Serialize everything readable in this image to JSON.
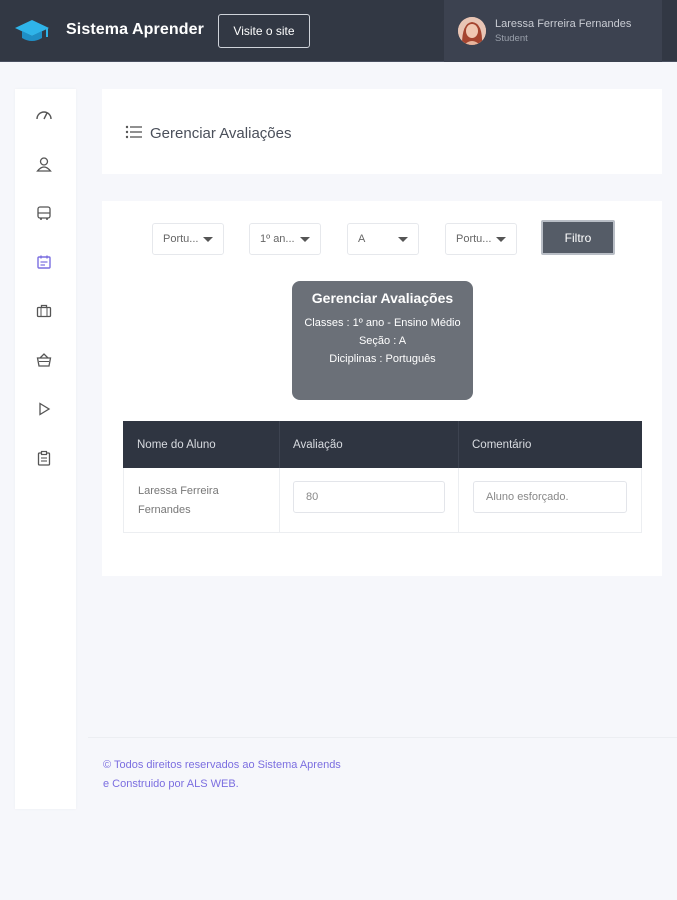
{
  "header": {
    "brand": "Sistema Aprender",
    "visit_label": "Visite o site",
    "user_name": "Laressa Ferreira Fernandes",
    "user_role": "Student"
  },
  "sidebar": {
    "items": [
      {
        "icon": "dashboard-gauge-icon"
      },
      {
        "icon": "user-icon"
      },
      {
        "icon": "bus-icon"
      },
      {
        "icon": "calendar-icon",
        "active": true
      },
      {
        "icon": "briefcase-icon"
      },
      {
        "icon": "basket-icon"
      },
      {
        "icon": "play-icon"
      },
      {
        "icon": "clipboard-icon"
      }
    ]
  },
  "page": {
    "title": "Gerenciar Avaliações"
  },
  "filters": {
    "discipline": "Portu...",
    "class": "1º an...",
    "section": "A",
    "discipline2": "Portu...",
    "filter_label": "Filtro"
  },
  "info": {
    "title": "Gerenciar Avaliações",
    "classes": "Classes : 1º ano - Ensino Médio",
    "section": "Seção : A",
    "disciplines": "Diciplinas : Português"
  },
  "table": {
    "headers": [
      "Nome do Aluno",
      "Avaliação",
      "Comentário"
    ],
    "rows": [
      {
        "name": "Laressa Ferreira Fernandes",
        "grade": "80",
        "comment": "Aluno esforçado."
      }
    ]
  },
  "footer": {
    "text": "© Todos direitos reservados ao Sistema Aprends e Construido por ALS WEB."
  },
  "colors": {
    "header_bg": "#323844",
    "accent": "#7b6ee0",
    "table_header": "#2f3541",
    "filter_btn": "#555c67"
  }
}
